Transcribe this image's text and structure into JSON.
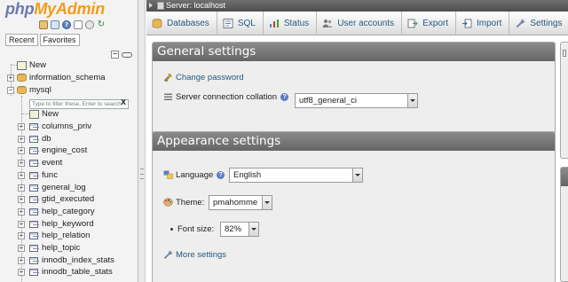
{
  "logo": {
    "php": "php",
    "admin": "MyAdmin"
  },
  "nav": {
    "recent_label": "Recent",
    "favorites_label": "Favorites",
    "filter_placeholder": "Type to filter these, Enter to search",
    "filter_clear": "X",
    "root_new": "New",
    "databases": [
      {
        "label": "information_schema"
      },
      {
        "label": "mysql"
      }
    ],
    "mysql_new": "New",
    "tables": [
      "columns_priv",
      "db",
      "engine_cost",
      "event",
      "func",
      "general_log",
      "gtid_executed",
      "help_category",
      "help_keyword",
      "help_relation",
      "help_topic",
      "innodb_index_stats",
      "innodb_table_stats"
    ]
  },
  "serverbar": {
    "title": "Server: localhost"
  },
  "menu": {
    "tabs": [
      {
        "label": "Databases",
        "icon": "databases-icon"
      },
      {
        "label": "SQL",
        "icon": "sql-icon"
      },
      {
        "label": "Status",
        "icon": "status-icon"
      },
      {
        "label": "User accounts",
        "icon": "user-accounts-icon"
      },
      {
        "label": "Export",
        "icon": "export-icon"
      },
      {
        "label": "Import",
        "icon": "import-icon"
      },
      {
        "label": "Settings",
        "icon": "settings-icon"
      }
    ]
  },
  "general": {
    "title": "General settings",
    "change_password": "Change password",
    "collation_label": "Server connection collation",
    "collation_value": "utf8_general_ci"
  },
  "appearance": {
    "title": "Appearance settings",
    "language_label": "Language",
    "language_value": "English",
    "theme_label": "Theme:",
    "theme_value": "pmahomme",
    "fontsize_label": "Font size:",
    "fontsize_value": "82%",
    "more_settings": "More settings"
  },
  "colors": {
    "link": "#235a81",
    "header_bg": "#777777",
    "panel_bg": "#eeeeee"
  }
}
